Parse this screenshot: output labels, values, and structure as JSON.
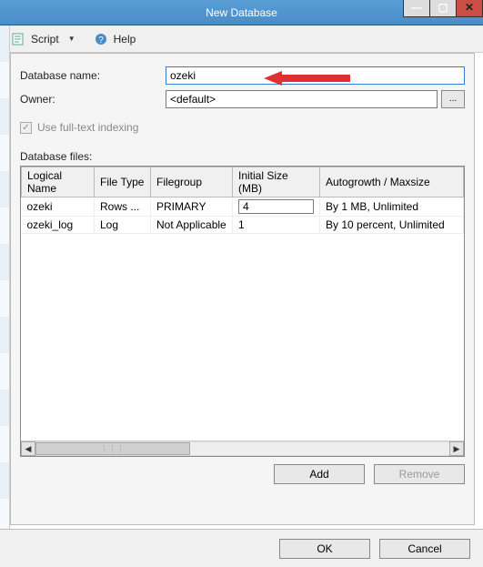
{
  "window": {
    "title": "New Database"
  },
  "toolbar": {
    "script_label": "Script",
    "help_label": "Help"
  },
  "form": {
    "db_name_label": "Database name:",
    "db_name_value": "ozeki",
    "owner_label": "Owner:",
    "owner_value": "<default>",
    "browse_label": "...",
    "fulltext_label": "Use full-text indexing"
  },
  "files": {
    "section_label": "Database files:",
    "columns": {
      "logical_name": "Logical Name",
      "file_type": "File Type",
      "filegroup": "Filegroup",
      "initial_size": "Initial Size (MB)",
      "autogrowth": "Autogrowth / Maxsize"
    },
    "rows": [
      {
        "logical_name": "ozeki",
        "file_type": "Rows ...",
        "filegroup": "PRIMARY",
        "initial_size": "4",
        "autogrowth": "By 1 MB, Unlimited"
      },
      {
        "logical_name": "ozeki_log",
        "file_type": "Log",
        "filegroup": "Not Applicable",
        "initial_size": "1",
        "autogrowth": "By 10 percent, Unlimited"
      }
    ]
  },
  "buttons": {
    "add": "Add",
    "remove": "Remove",
    "ok": "OK",
    "cancel": "Cancel"
  }
}
